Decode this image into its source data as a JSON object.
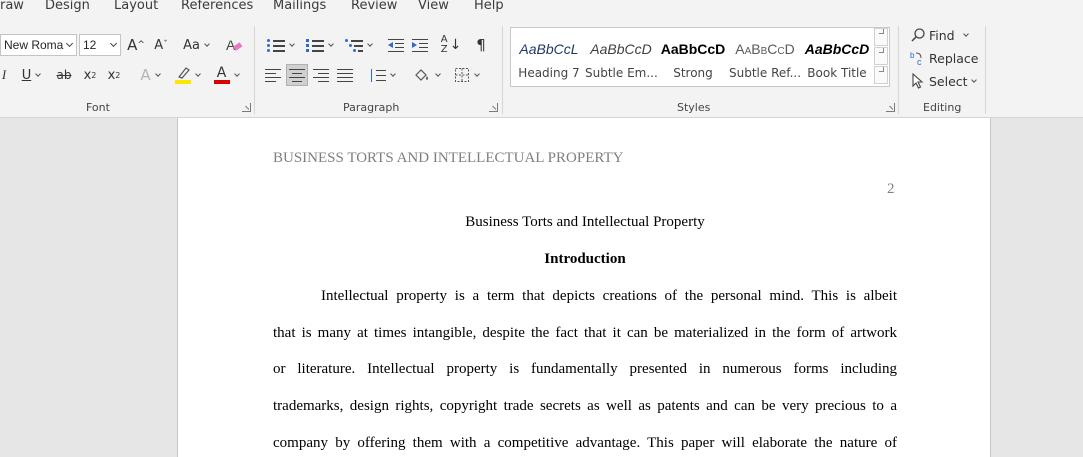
{
  "ribbon": {
    "tabs": [
      "raw",
      "Design",
      "Layout",
      "References",
      "Mailings",
      "Review",
      "View",
      "Help"
    ],
    "font": {
      "name": "New Roma",
      "size": "12",
      "grow_glyph": "A",
      "shrink_glyph": "A",
      "change_case": "Aa",
      "underline": "U",
      "strike": "ab",
      "subscript": "x",
      "superscript": "x",
      "text_effects": "A",
      "font_color_glyph": "A",
      "label": "Font"
    },
    "paragraph": {
      "label": "Paragraph",
      "pilcrow": "¶"
    },
    "styles": {
      "label": "Styles",
      "items": [
        {
          "sample": "AaBbCcL",
          "name": "Heading 7"
        },
        {
          "sample": "AaBbCcD",
          "name": "Subtle Em..."
        },
        {
          "sample": "AaBbCcD",
          "name": "Strong"
        },
        {
          "sample": "AaBbCcD",
          "name": "Subtle Ref..."
        },
        {
          "sample": "AaBbCcD",
          "name": "Book Title"
        }
      ]
    },
    "editing": {
      "label": "Editing",
      "find": "Find",
      "replace": "Replace",
      "select": "Select"
    },
    "colors": {
      "highlight": "#ffe600",
      "font_color": "#d80000"
    }
  },
  "document": {
    "header_text": "BUSINESS TORTS AND INTELLECTUAL PROPERTY",
    "page_number": "2",
    "title": "Business Torts and Intellectual Property",
    "heading": "Introduction",
    "lines": [
      "Intellectual property is a term that depicts creations of the personal mind. This is albeit",
      "that is many at times intangible, despite the fact that it can be materialized in the form of artwork",
      "or literature. Intellectual property is fundamentally presented in numerous forms including",
      "trademarks, design rights, copyright trade secrets as well as patents and can be very precious to a",
      "company by offering them with a competitive advantage. This paper will elaborate the nature of"
    ]
  }
}
